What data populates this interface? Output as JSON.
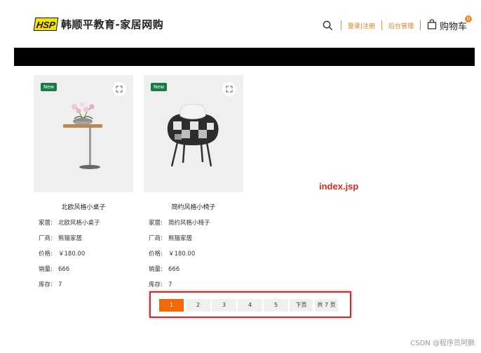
{
  "header": {
    "logo": "HSP",
    "title": "韩顺平教育-家居网购",
    "nav": {
      "search_icon": "search-icon",
      "login": "登录|注册",
      "admin": "后台管理",
      "cart_label": "购物车",
      "cart_count": "0"
    }
  },
  "colors": {
    "accent": "#f06a0a",
    "new_badge": "#1a7a45",
    "top_bar": "#000000",
    "annotation": "#e8251d"
  },
  "products": [
    {
      "badge": "New",
      "name": "北欧风格小桌子",
      "attrs": [
        {
          "k": "家居:",
          "v": "北欧风格小桌子"
        },
        {
          "k": "厂商:",
          "v": "熊猫家居"
        },
        {
          "k": "价格:",
          "v": "￥180.00"
        },
        {
          "k": "销量:",
          "v": "666"
        },
        {
          "k": "库存:",
          "v": "7"
        }
      ]
    },
    {
      "badge": "New",
      "name": "简约风格小椅子",
      "attrs": [
        {
          "k": "家居:",
          "v": "简约风格小椅子"
        },
        {
          "k": "厂商:",
          "v": "熊猫家居"
        },
        {
          "k": "价格:",
          "v": "￥180.00"
        },
        {
          "k": "销量:",
          "v": "666"
        },
        {
          "k": "库存:",
          "v": "7"
        }
      ]
    }
  ],
  "pagination": {
    "pages": [
      "1",
      "2",
      "3",
      "4",
      "5"
    ],
    "current": "1",
    "next": "下页",
    "total": "共 7 页"
  },
  "annotation": "index.jsp",
  "watermark": "CSDN @程序员阿鹏"
}
